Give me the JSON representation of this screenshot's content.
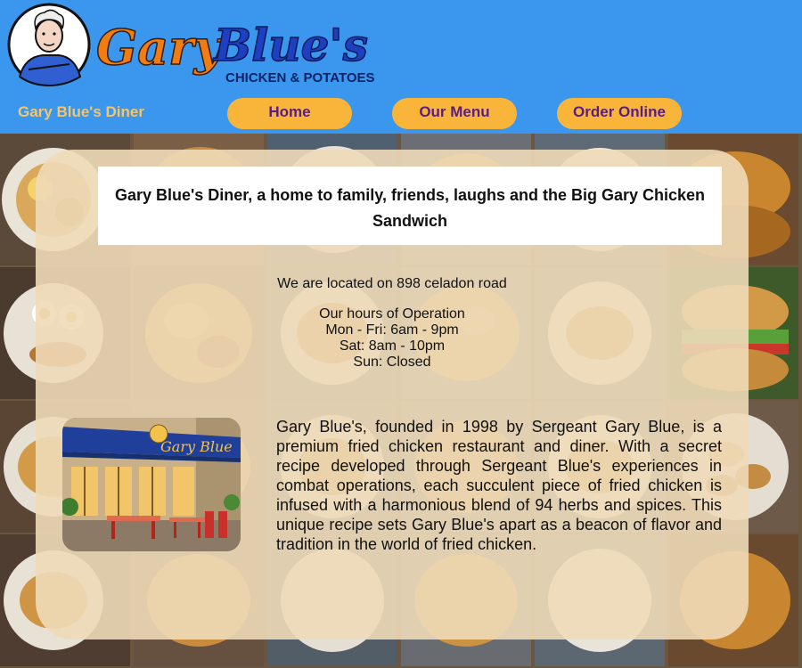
{
  "header": {
    "logo_name": "Gary Blue's",
    "logo_tagline": "CHICKEN & POTATOES",
    "brand": "Gary Blue's Diner",
    "nav": [
      {
        "label": "Home"
      },
      {
        "label": "Our Menu"
      },
      {
        "label": "Order Online"
      }
    ]
  },
  "main": {
    "headline": "Gary Blue's Diner, a home to family, friends, laughs and the Big Gary Chicken Sandwich",
    "location": "We are located on 898 celadon road",
    "hours": {
      "title": "Our hours of Operation",
      "lines": [
        "Mon - Fri: 6am - 9pm",
        "Sat: 8am - 10pm",
        "Sun: Closed"
      ]
    },
    "photo_sign": "Gary Blue",
    "about": "Gary Blue's, founded in 1998 by Sergeant Gary Blue, is a premium fried chicken restaurant and diner. With a secret recipe developed through Sergeant Blue's experiences in combat operations, each succulent piece of fried chicken is infused with a harmonious blend of 94 herbs and spices. This unique recipe sets Gary Blue's apart as a beacon of flavor and tradition in the world of fried chicken."
  },
  "colors": {
    "header_bg": "#3b97ee",
    "nav_button": "#f9b53a",
    "nav_text": "#5a1d84",
    "brand_text": "#f6c56a",
    "logo_orange": "#f07c12",
    "logo_blue": "#1e3fbf"
  }
}
